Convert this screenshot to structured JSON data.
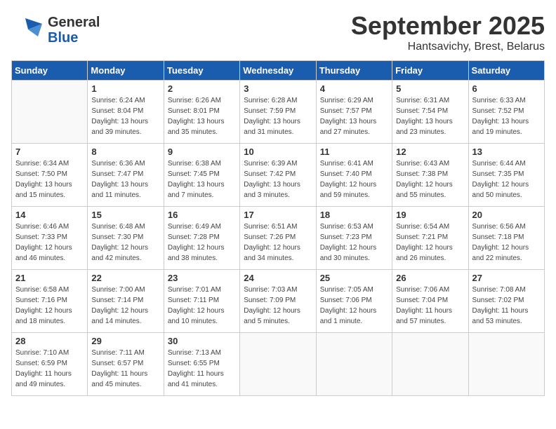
{
  "header": {
    "logo_general": "General",
    "logo_blue": "Blue",
    "month": "September 2025",
    "location": "Hantsavichy, Brest, Belarus"
  },
  "weekdays": [
    "Sunday",
    "Monday",
    "Tuesday",
    "Wednesday",
    "Thursday",
    "Friday",
    "Saturday"
  ],
  "weeks": [
    [
      {
        "day": "",
        "info": ""
      },
      {
        "day": "1",
        "info": "Sunrise: 6:24 AM\nSunset: 8:04 PM\nDaylight: 13 hours\nand 39 minutes."
      },
      {
        "day": "2",
        "info": "Sunrise: 6:26 AM\nSunset: 8:01 PM\nDaylight: 13 hours\nand 35 minutes."
      },
      {
        "day": "3",
        "info": "Sunrise: 6:28 AM\nSunset: 7:59 PM\nDaylight: 13 hours\nand 31 minutes."
      },
      {
        "day": "4",
        "info": "Sunrise: 6:29 AM\nSunset: 7:57 PM\nDaylight: 13 hours\nand 27 minutes."
      },
      {
        "day": "5",
        "info": "Sunrise: 6:31 AM\nSunset: 7:54 PM\nDaylight: 13 hours\nand 23 minutes."
      },
      {
        "day": "6",
        "info": "Sunrise: 6:33 AM\nSunset: 7:52 PM\nDaylight: 13 hours\nand 19 minutes."
      }
    ],
    [
      {
        "day": "7",
        "info": "Sunrise: 6:34 AM\nSunset: 7:50 PM\nDaylight: 13 hours\nand 15 minutes."
      },
      {
        "day": "8",
        "info": "Sunrise: 6:36 AM\nSunset: 7:47 PM\nDaylight: 13 hours\nand 11 minutes."
      },
      {
        "day": "9",
        "info": "Sunrise: 6:38 AM\nSunset: 7:45 PM\nDaylight: 13 hours\nand 7 minutes."
      },
      {
        "day": "10",
        "info": "Sunrise: 6:39 AM\nSunset: 7:42 PM\nDaylight: 13 hours\nand 3 minutes."
      },
      {
        "day": "11",
        "info": "Sunrise: 6:41 AM\nSunset: 7:40 PM\nDaylight: 12 hours\nand 59 minutes."
      },
      {
        "day": "12",
        "info": "Sunrise: 6:43 AM\nSunset: 7:38 PM\nDaylight: 12 hours\nand 55 minutes."
      },
      {
        "day": "13",
        "info": "Sunrise: 6:44 AM\nSunset: 7:35 PM\nDaylight: 12 hours\nand 50 minutes."
      }
    ],
    [
      {
        "day": "14",
        "info": "Sunrise: 6:46 AM\nSunset: 7:33 PM\nDaylight: 12 hours\nand 46 minutes."
      },
      {
        "day": "15",
        "info": "Sunrise: 6:48 AM\nSunset: 7:30 PM\nDaylight: 12 hours\nand 42 minutes."
      },
      {
        "day": "16",
        "info": "Sunrise: 6:49 AM\nSunset: 7:28 PM\nDaylight: 12 hours\nand 38 minutes."
      },
      {
        "day": "17",
        "info": "Sunrise: 6:51 AM\nSunset: 7:26 PM\nDaylight: 12 hours\nand 34 minutes."
      },
      {
        "day": "18",
        "info": "Sunrise: 6:53 AM\nSunset: 7:23 PM\nDaylight: 12 hours\nand 30 minutes."
      },
      {
        "day": "19",
        "info": "Sunrise: 6:54 AM\nSunset: 7:21 PM\nDaylight: 12 hours\nand 26 minutes."
      },
      {
        "day": "20",
        "info": "Sunrise: 6:56 AM\nSunset: 7:18 PM\nDaylight: 12 hours\nand 22 minutes."
      }
    ],
    [
      {
        "day": "21",
        "info": "Sunrise: 6:58 AM\nSunset: 7:16 PM\nDaylight: 12 hours\nand 18 minutes."
      },
      {
        "day": "22",
        "info": "Sunrise: 7:00 AM\nSunset: 7:14 PM\nDaylight: 12 hours\nand 14 minutes."
      },
      {
        "day": "23",
        "info": "Sunrise: 7:01 AM\nSunset: 7:11 PM\nDaylight: 12 hours\nand 10 minutes."
      },
      {
        "day": "24",
        "info": "Sunrise: 7:03 AM\nSunset: 7:09 PM\nDaylight: 12 hours\nand 5 minutes."
      },
      {
        "day": "25",
        "info": "Sunrise: 7:05 AM\nSunset: 7:06 PM\nDaylight: 12 hours\nand 1 minute."
      },
      {
        "day": "26",
        "info": "Sunrise: 7:06 AM\nSunset: 7:04 PM\nDaylight: 11 hours\nand 57 minutes."
      },
      {
        "day": "27",
        "info": "Sunrise: 7:08 AM\nSunset: 7:02 PM\nDaylight: 11 hours\nand 53 minutes."
      }
    ],
    [
      {
        "day": "28",
        "info": "Sunrise: 7:10 AM\nSunset: 6:59 PM\nDaylight: 11 hours\nand 49 minutes."
      },
      {
        "day": "29",
        "info": "Sunrise: 7:11 AM\nSunset: 6:57 PM\nDaylight: 11 hours\nand 45 minutes."
      },
      {
        "day": "30",
        "info": "Sunrise: 7:13 AM\nSunset: 6:55 PM\nDaylight: 11 hours\nand 41 minutes."
      },
      {
        "day": "",
        "info": ""
      },
      {
        "day": "",
        "info": ""
      },
      {
        "day": "",
        "info": ""
      },
      {
        "day": "",
        "info": ""
      }
    ]
  ]
}
